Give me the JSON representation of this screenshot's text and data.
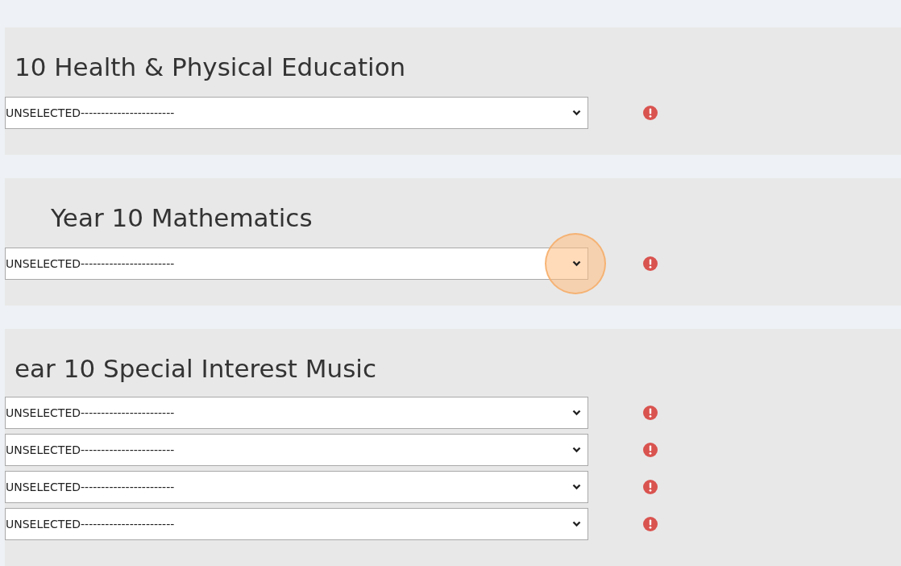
{
  "sections": [
    {
      "title": "10 Health & Physical Education",
      "indented": false,
      "selects": [
        {
          "value": "UNSELECTED-----------------------",
          "highlighted": false,
          "error": true
        }
      ]
    },
    {
      "title": "Year 10 Mathematics",
      "indented": true,
      "selects": [
        {
          "value": "UNSELECTED-----------------------",
          "highlighted": true,
          "error": true
        }
      ]
    },
    {
      "title": "ear 10 Special Interest Music",
      "indented": false,
      "selects": [
        {
          "value": "UNSELECTED-----------------------",
          "highlighted": false,
          "error": true
        },
        {
          "value": "UNSELECTED-----------------------",
          "highlighted": false,
          "error": true
        },
        {
          "value": "UNSELECTED-----------------------",
          "highlighted": false,
          "error": true
        },
        {
          "value": "UNSELECTED-----------------------",
          "highlighted": false,
          "error": true
        }
      ]
    }
  ]
}
